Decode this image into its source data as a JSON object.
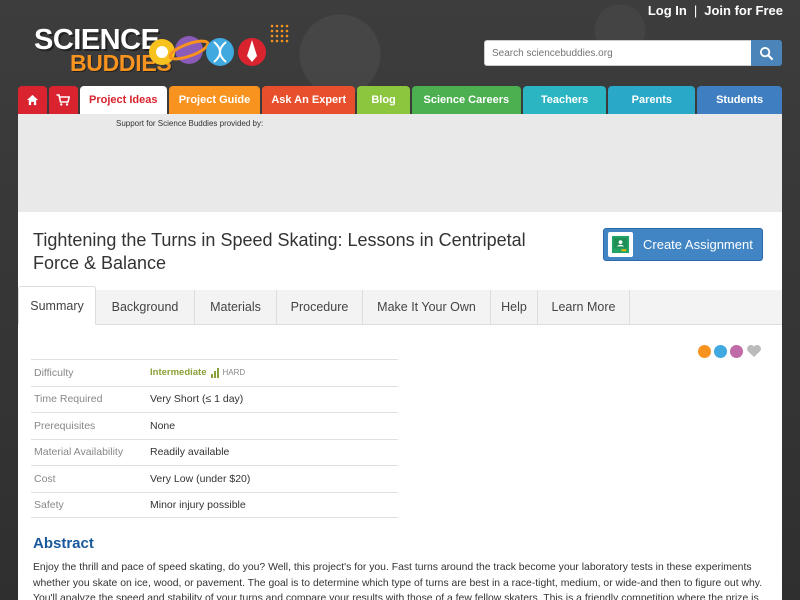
{
  "header": {
    "logo_line1": "SCIENCE",
    "logo_line2": "BUDDIES",
    "login": "Log In",
    "separator": "|",
    "join": "Join for Free",
    "search_placeholder": "Search sciencebuddies.org"
  },
  "nav": {
    "items": [
      {
        "label": "Project Ideas",
        "color": "#ffffff"
      },
      {
        "label": "Project Guide",
        "color": "#f7931e"
      },
      {
        "label": "Ask An Expert",
        "color": "#e84f2c"
      },
      {
        "label": "Blog",
        "color": "#8cc63f"
      },
      {
        "label": "Science Careers",
        "color": "#4caf50"
      },
      {
        "label": "Teachers",
        "color": "#2bb5c2"
      },
      {
        "label": "Parents",
        "color": "#2aa8c7"
      },
      {
        "label": "Students",
        "color": "#3f7fc1"
      }
    ],
    "home_icon": "home-icon",
    "cart_icon": "cart-icon"
  },
  "ad": {
    "label": "Support for Science Buddies provided by:"
  },
  "page": {
    "title": "Tightening the Turns in Speed Skating: Lessons in Centripetal Force & Balance",
    "create_assignment": "Create Assignment"
  },
  "tabs": [
    "Summary",
    "Background",
    "Materials",
    "Procedure",
    "Make It Your Own",
    "Help",
    "Learn More"
  ],
  "summary": {
    "rows": [
      {
        "label": "Difficulty",
        "value": "Intermediate",
        "extra": "HARD"
      },
      {
        "label": "Time Required",
        "value": "Very Short (≤ 1 day)"
      },
      {
        "label": "Prerequisites",
        "value": "None"
      },
      {
        "label": "Material Availability",
        "value": "Readily available"
      },
      {
        "label": "Cost",
        "value": "Very Low (under $20)"
      },
      {
        "label": "Safety",
        "value": "Minor injury possible"
      }
    ]
  },
  "abstract": {
    "heading": "Abstract",
    "text": "Enjoy the thrill and pace of speed skating, do you? Well, this project's for you. Fast turns around the track become your laboratory tests in these experiments whether you skate on ice, wood, or pavement. The goal is to determine which type of turns are best in a race-tight, medium, or wide-and then to figure out why. You'll analyze the speed and stability of your turns and compare your results with those of a few fellow skaters. This is a friendly competition where the prize is"
  },
  "colors": {
    "brand_red": "#d9232e",
    "brand_orange": "#f7931e",
    "link_blue": "#1a5a9c",
    "button_blue": "#4285c4"
  }
}
